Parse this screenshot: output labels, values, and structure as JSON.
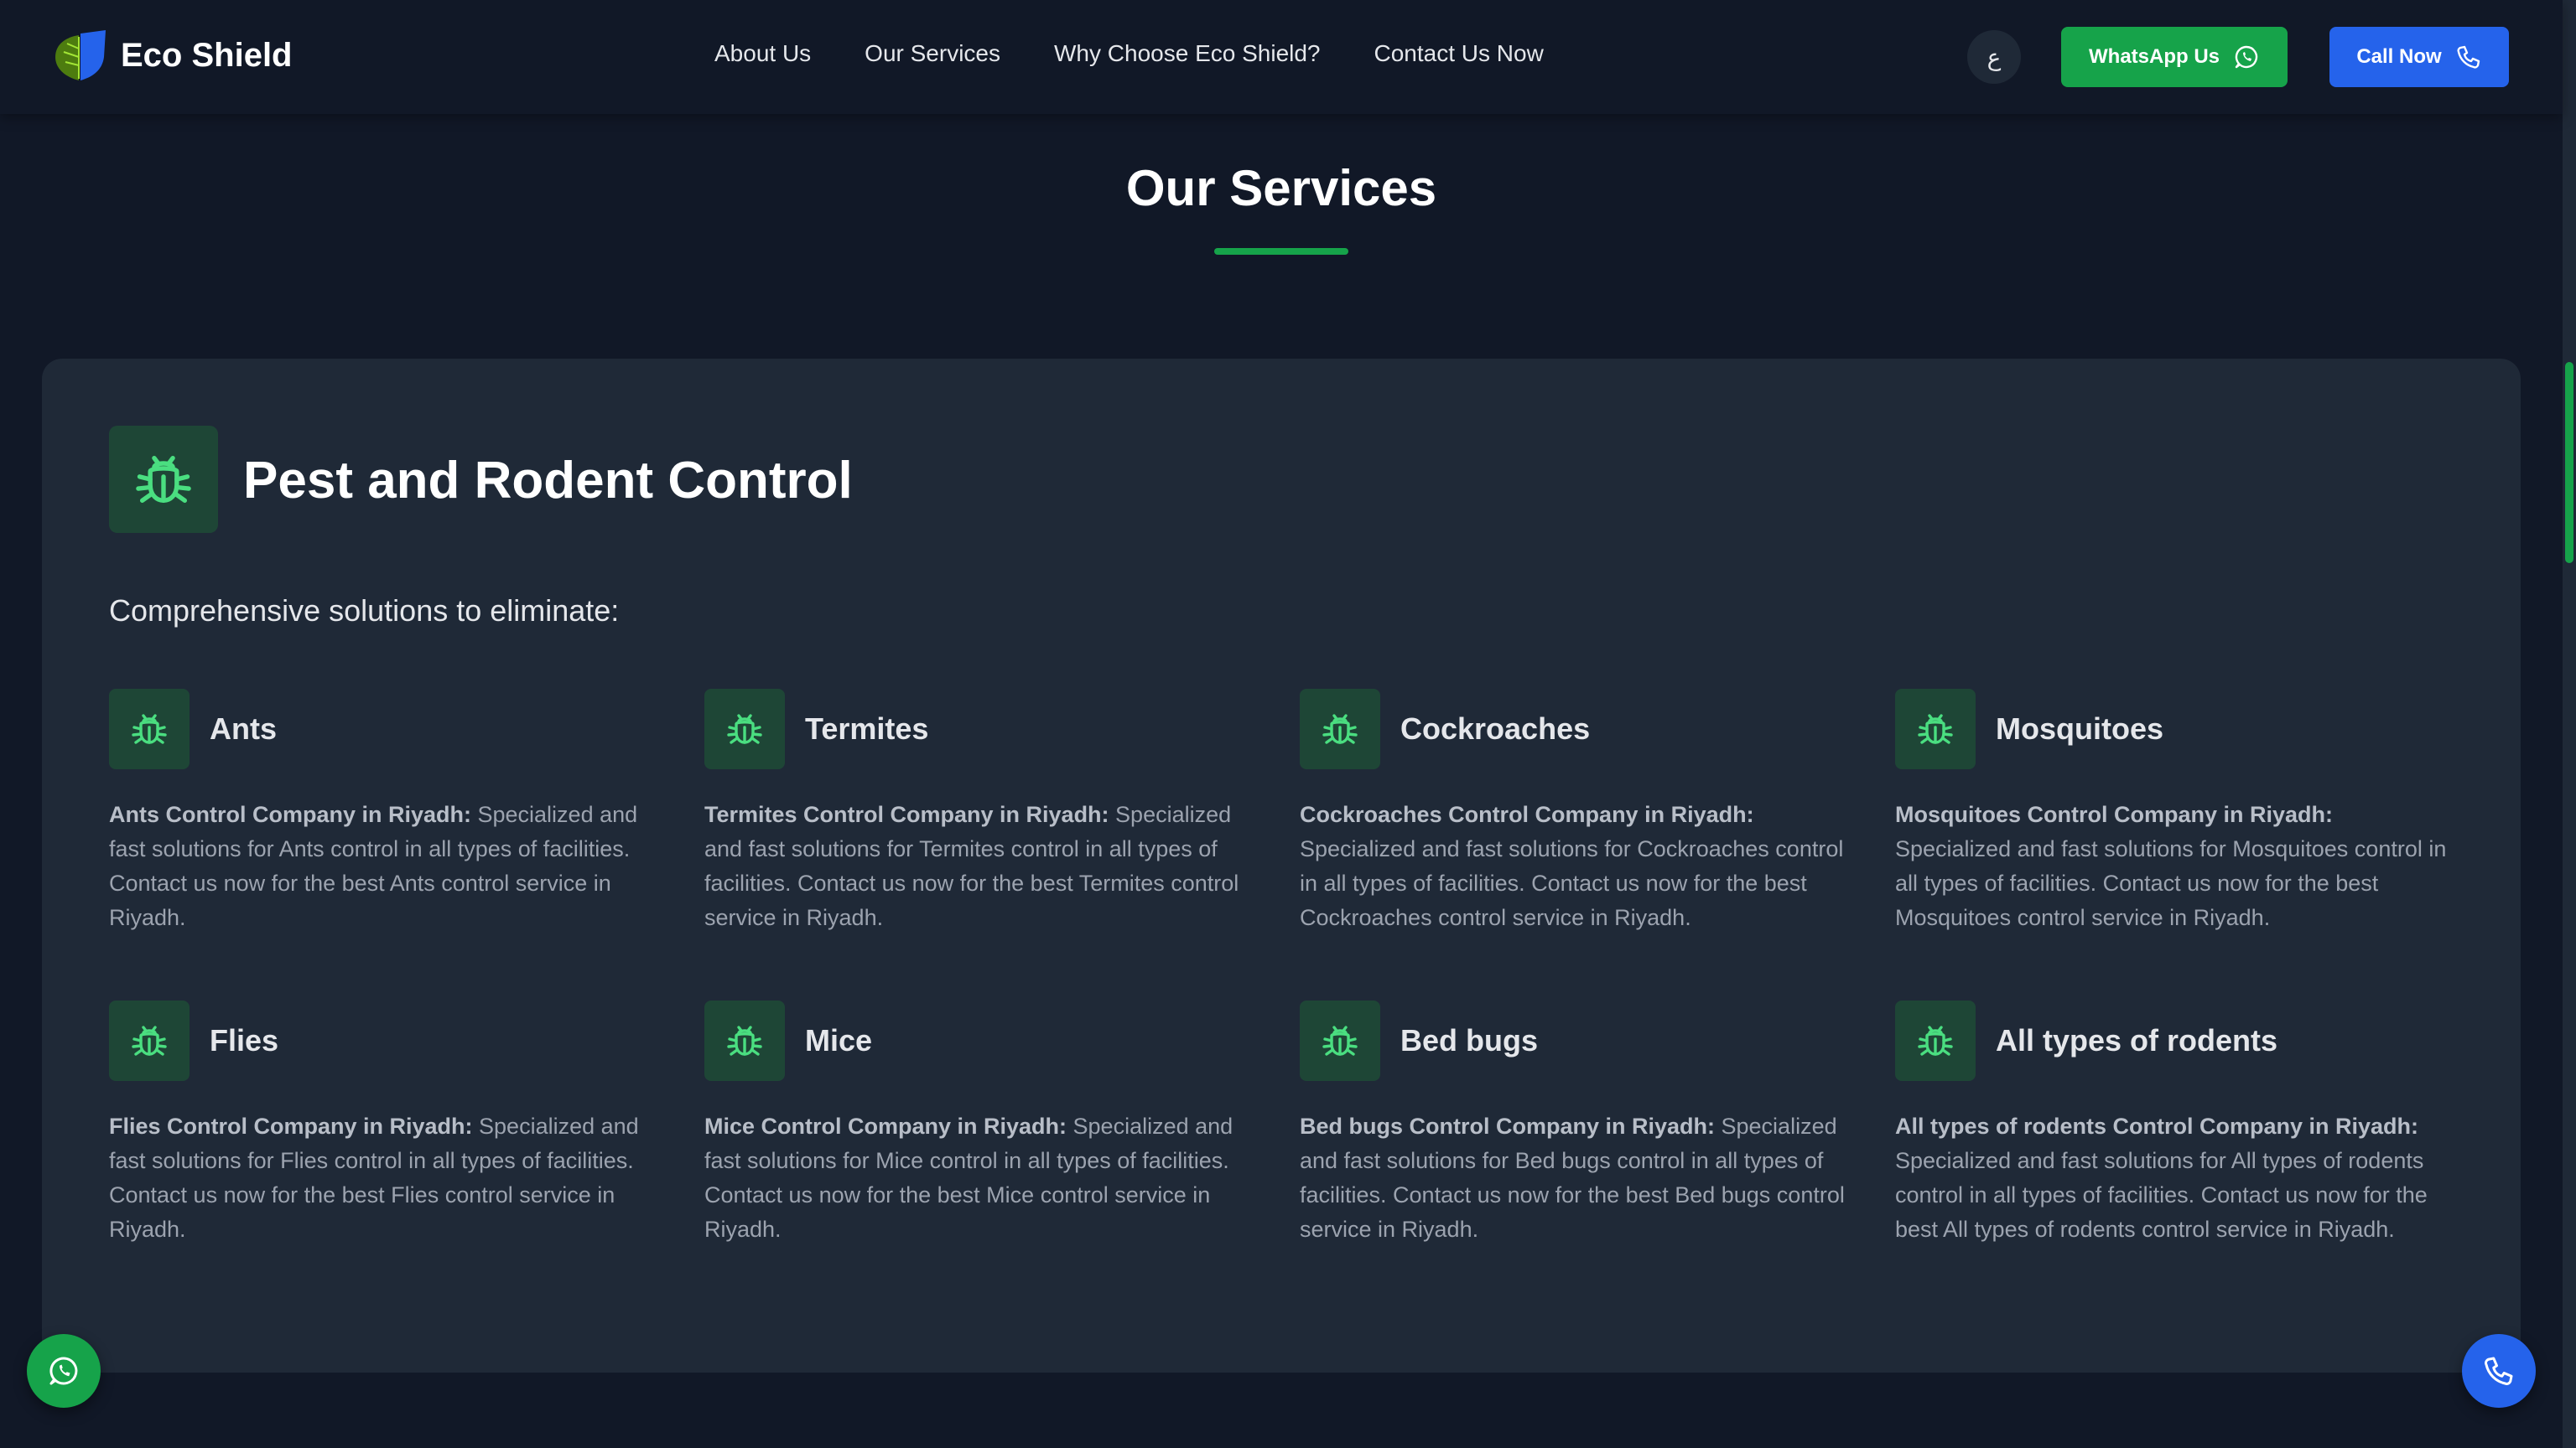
{
  "brand": {
    "name": "Eco Shield"
  },
  "nav": [
    {
      "label": "About Us"
    },
    {
      "label": "Our Services"
    },
    {
      "label": "Why Choose Eco Shield?"
    },
    {
      "label": "Contact Us Now"
    }
  ],
  "header": {
    "lang_label": "ع",
    "whatsapp_label": "WhatsApp Us",
    "call_label": "Call Now"
  },
  "section": {
    "title": "Our Services"
  },
  "card": {
    "title": "Pest and Rodent Control",
    "subtitle": "Comprehensive solutions to eliminate:",
    "items": [
      {
        "name": "Ants",
        "lead": "Ants Control Company in Riyadh:",
        "text": " Specialized and fast solutions for Ants control in all types of facilities. Contact us now for the best Ants control service in Riyadh."
      },
      {
        "name": "Termites",
        "lead": "Termites Control Company in Riyadh:",
        "text": " Specialized and fast solutions for Termites control in all types of facilities. Contact us now for the best Termites control service in Riyadh."
      },
      {
        "name": "Cockroaches",
        "lead": "Cockroaches Control Company in Riyadh:",
        "text": " Specialized and fast solutions for Cockroaches control in all types of facilities. Contact us now for the best Cockroaches control service in Riyadh."
      },
      {
        "name": "Mosquitoes",
        "lead": "Mosquitoes Control Company in Riyadh:",
        "text": " Specialized and fast solutions for Mosquitoes control in all types of facilities. Contact us now for the best Mosquitoes control service in Riyadh."
      },
      {
        "name": "Flies",
        "lead": "Flies Control Company in Riyadh:",
        "text": " Specialized and fast solutions for Flies control in all types of facilities. Contact us now for the best Flies control service in Riyadh."
      },
      {
        "name": "Mice",
        "lead": "Mice Control Company in Riyadh:",
        "text": " Specialized and fast solutions for Mice control in all types of facilities. Contact us now for the best Mice control service in Riyadh."
      },
      {
        "name": "Bed bugs",
        "lead": "Bed bugs Control Company in Riyadh:",
        "text": " Specialized and fast solutions for Bed bugs control in all types of facilities. Contact us now for the best Bed bugs control service in Riyadh."
      },
      {
        "name": "All types of rodents",
        "lead": "All types of rodents Control Company in Riyadh:",
        "text": " Specialized and fast solutions for All types of rodents control in all types of facilities. Contact us now for the best All types of rodents control service in Riyadh."
      }
    ]
  },
  "icons": {
    "logo": "shield-leaf-icon",
    "bug": "bug-icon",
    "whatsapp": "whatsapp-icon",
    "phone": "phone-icon"
  },
  "colors": {
    "background": "#111827",
    "card": "#1f2937",
    "accent_green": "#16a34a",
    "accent_blue": "#2563eb",
    "icon_green": "#4ade80"
  }
}
